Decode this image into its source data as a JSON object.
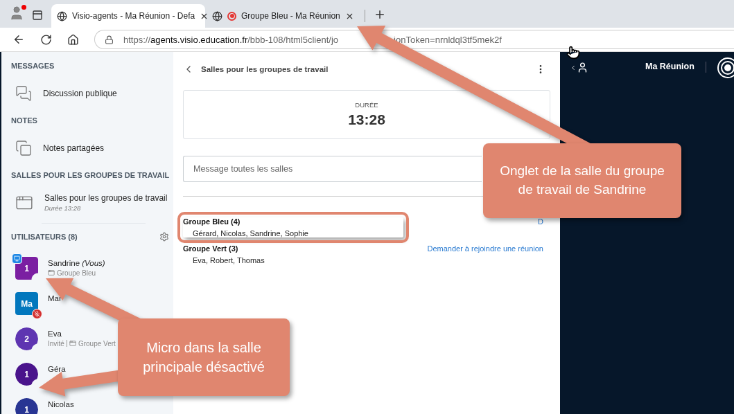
{
  "browser": {
    "tabs": [
      {
        "title": "Visio-agents - Ma Réunion - Defa",
        "selected": true,
        "recording": false
      },
      {
        "title": "Groupe Bleu - Ma Réunion",
        "selected": false,
        "recording": true
      }
    ],
    "address": {
      "url_start": "https://**agents.visio.education.fr**/bbb-108/html5client/jo",
      "url_end": "ionToken=nrnldql3tf5mek2f"
    }
  },
  "sidebar": {
    "sections": [
      {
        "heading": "MESSAGES",
        "items": [
          {
            "kind": "chat",
            "label": "Discussion publique"
          }
        ]
      },
      {
        "heading": "NOTES",
        "items": [
          {
            "kind": "notes",
            "label": "Notes partagées"
          }
        ]
      },
      {
        "heading": "SALLES POUR LES GROUPES DE TRAVAIL",
        "items": [
          {
            "kind": "rooms",
            "label": "Salles pour les groupes de travail",
            "sub": "Durée 13:28"
          }
        ]
      }
    ],
    "users": {
      "heading": "UTILISATEURS (8)",
      "list": [
        {
          "kind": "moderator",
          "avatar": "1",
          "color": "#7b1fa2",
          "name": "Sandrine",
          "tag": "(Vous)",
          "room": "Groupe Bleu",
          "presenter": true,
          "muted": false,
          "in_breakout": true
        },
        {
          "kind": "moderator",
          "avatar": "Ma",
          "color": "#0277bd",
          "name": "Mar",
          "presenter": false,
          "muted": true,
          "in_breakout": false
        },
        {
          "kind": "viewer",
          "avatar": "2",
          "color": "#5e35b1",
          "name": "Eva",
          "role": "Invité",
          "room": "Groupe Vert",
          "presenter": false,
          "muted": false,
          "in_breakout": true
        },
        {
          "kind": "viewer",
          "avatar": "1",
          "color": "#4a148c",
          "name": "Géra",
          "presenter": false,
          "muted": false,
          "in_breakout": true
        },
        {
          "kind": "viewer",
          "avatar": "1",
          "color": "#283593",
          "name": "Nicolas",
          "presenter": false,
          "muted": false,
          "in_breakout": true
        }
      ]
    }
  },
  "main": {
    "title": "Salles pour les groupes de travail",
    "duration_label": "DURÉE",
    "duration": "13:28",
    "message_placeholder": "Message toutes les salles",
    "groups": [
      {
        "name": "Groupe Bleu (4)",
        "members": "Gérard, Nicolas, Sandrine, Sophie",
        "action": "D",
        "highlighted": true
      },
      {
        "name": "Groupe Vert (3)",
        "members": "Eva, Robert, Thomas",
        "action": "Demander à rejoindre une réunion",
        "highlighted": false
      }
    ]
  },
  "meeting": {
    "title": "Ma Réunion"
  },
  "annotations": [
    {
      "kind": "tab",
      "text": "Onglet de la salle du groupe de travail de Sandrine"
    },
    {
      "kind": "micro",
      "text": "Micro dans la salle principale désactivé"
    }
  ]
}
